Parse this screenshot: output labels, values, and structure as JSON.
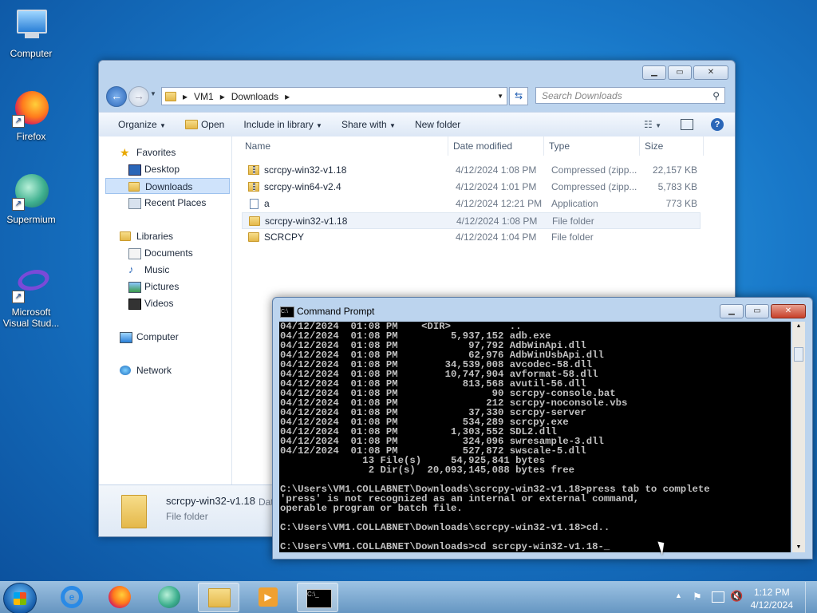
{
  "desktop": {
    "icons": [
      {
        "label": "Computer"
      },
      {
        "label": "Firefox"
      },
      {
        "label": "Supermium"
      },
      {
        "label": "Microsoft Visual Stud..."
      }
    ]
  },
  "explorer": {
    "breadcrumb": [
      "VM1",
      "Downloads"
    ],
    "search_placeholder": "Search Downloads",
    "toolbar": {
      "organize": "Organize",
      "open": "Open",
      "include": "Include in library",
      "share": "Share with",
      "new_folder": "New folder"
    },
    "nav": {
      "favorites": "Favorites",
      "desktop": "Desktop",
      "downloads": "Downloads",
      "recent": "Recent Places",
      "libraries": "Libraries",
      "documents": "Documents",
      "music": "Music",
      "pictures": "Pictures",
      "videos": "Videos",
      "computer": "Computer",
      "network": "Network"
    },
    "columns": {
      "name": "Name",
      "date": "Date modified",
      "type": "Type",
      "size": "Size"
    },
    "files": [
      {
        "name": "scrcpy-win32-v1.18",
        "date": "4/12/2024 1:08 PM",
        "type": "Compressed (zipp...",
        "size": "22,157 KB",
        "kind": "zip"
      },
      {
        "name": "scrcpy-win64-v2.4",
        "date": "4/12/2024 1:01 PM",
        "type": "Compressed (zipp...",
        "size": "5,783 KB",
        "kind": "zip"
      },
      {
        "name": "a",
        "date": "4/12/2024 12:21 PM",
        "type": "Application",
        "size": "773 KB",
        "kind": "app"
      },
      {
        "name": "scrcpy-win32-v1.18",
        "date": "4/12/2024 1:08 PM",
        "type": "File folder",
        "size": "",
        "kind": "folder"
      },
      {
        "name": "SCRCPY",
        "date": "4/12/2024 1:04 PM",
        "type": "File folder",
        "size": "",
        "kind": "folder"
      }
    ],
    "details": {
      "name": "scrcpy-win32-v1.18",
      "type": "File folder",
      "extra": "Dat"
    }
  },
  "cmd": {
    "title": "Command Prompt",
    "lines": [
      "04/12/2024  01:08 PM    <DIR>          ..",
      "04/12/2024  01:08 PM         5,937,152 adb.exe",
      "04/12/2024  01:08 PM            97,792 AdbWinApi.dll",
      "04/12/2024  01:08 PM            62,976 AdbWinUsbApi.dll",
      "04/12/2024  01:08 PM        34,539,008 avcodec-58.dll",
      "04/12/2024  01:08 PM        10,747,904 avformat-58.dll",
      "04/12/2024  01:08 PM           813,568 avutil-56.dll",
      "04/12/2024  01:08 PM                90 scrcpy-console.bat",
      "04/12/2024  01:08 PM               212 scrcpy-noconsole.vbs",
      "04/12/2024  01:08 PM            37,330 scrcpy-server",
      "04/12/2024  01:08 PM           534,289 scrcpy.exe",
      "04/12/2024  01:08 PM         1,303,552 SDL2.dll",
      "04/12/2024  01:08 PM           324,096 swresample-3.dll",
      "04/12/2024  01:08 PM           527,872 swscale-5.dll",
      "              13 File(s)     54,925,841 bytes",
      "               2 Dir(s)  20,093,145,088 bytes free",
      "",
      "C:\\Users\\VM1.COLLABNET\\Downloads\\scrcpy-win32-v1.18>press tab to complete",
      "'press' is not recognized as an internal or external command,",
      "operable program or batch file.",
      "",
      "C:\\Users\\VM1.COLLABNET\\Downloads\\scrcpy-win32-v1.18>cd..",
      "",
      "C:\\Users\\VM1.COLLABNET\\Downloads>cd scrcpy-win32-v1.18-_"
    ]
  },
  "taskbar": {
    "time": "1:12 PM",
    "date": "4/12/2024"
  }
}
